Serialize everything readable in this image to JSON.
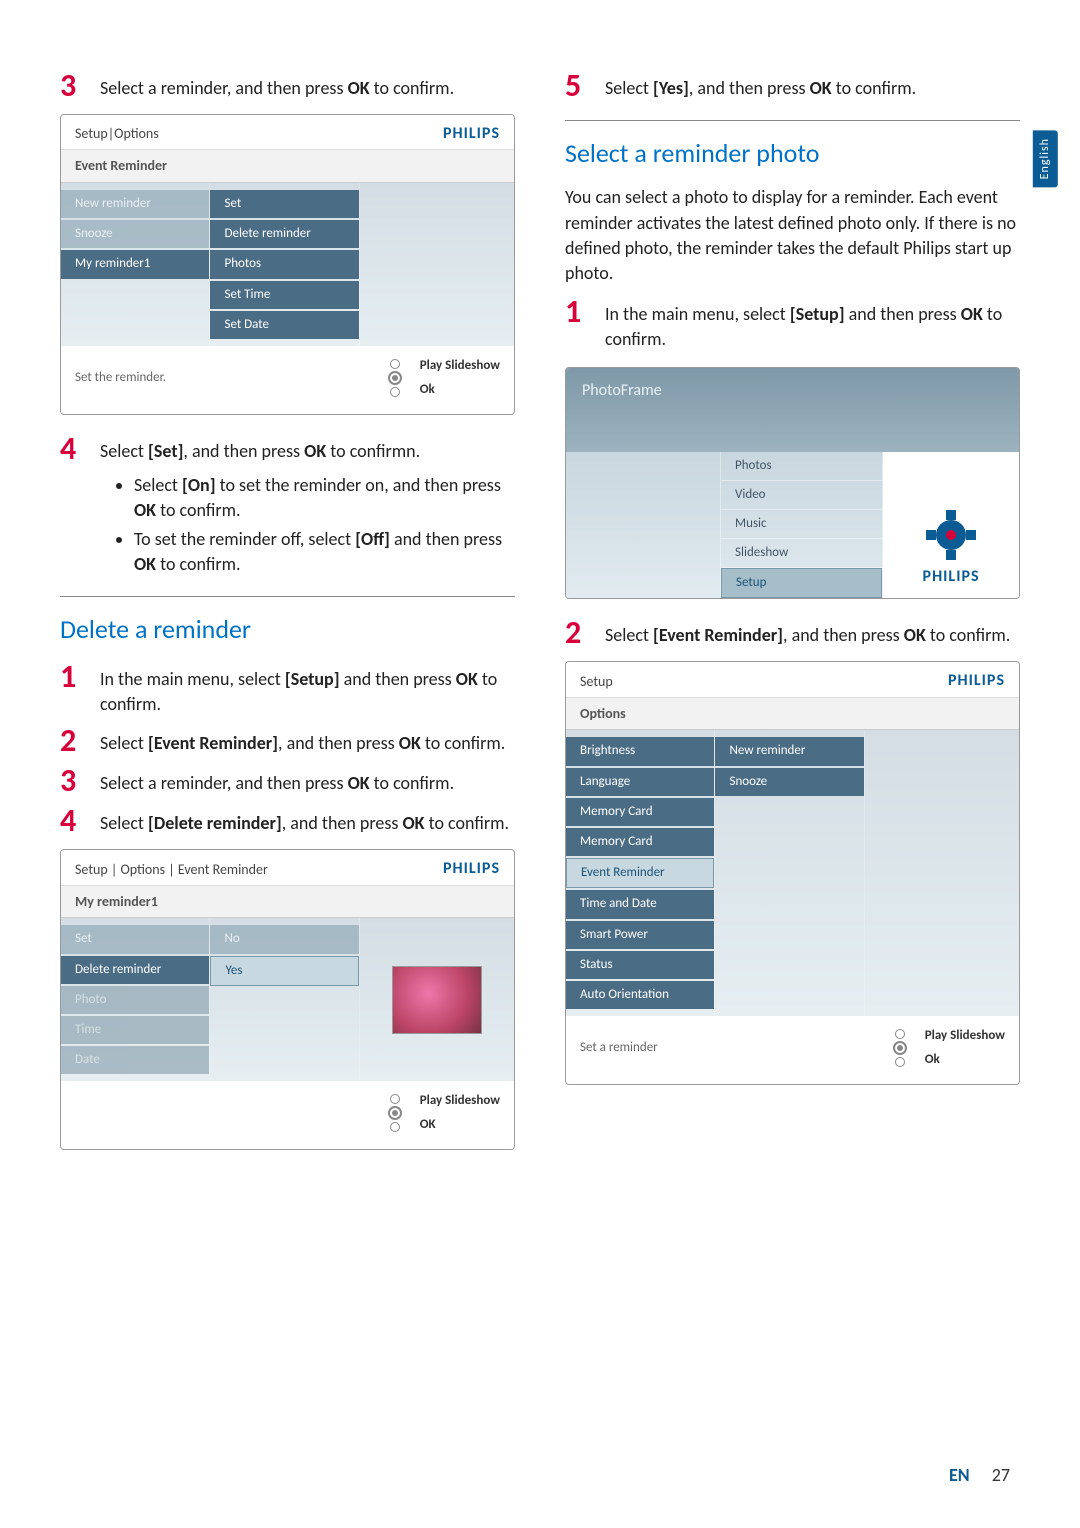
{
  "lang_tab": "English",
  "left": {
    "step3": {
      "num": "3",
      "text_a": "Select a reminder, and then press ",
      "ok": "OK",
      "text_b": " to confirm."
    },
    "device1": {
      "title": "Setup|Options",
      "brand": "PHILIPS",
      "subtitle": "Event Reminder",
      "col1": [
        "New reminder",
        "Snooze",
        "My reminder1"
      ],
      "col2": [
        "Set",
        "Delete reminder",
        "Photos",
        "Set Time",
        "Set Date"
      ],
      "footer_left": "Set the reminder.",
      "footer_labels": [
        "Play Slideshow",
        "Ok"
      ]
    },
    "step4": {
      "num": "4",
      "text_a": "Select ",
      "set": "[Set]",
      "text_b": ", and then press ",
      "ok": "OK",
      "text_c": " to confirmn.",
      "bullets": [
        {
          "a": "Select ",
          "b": "[On]",
          "c": " to set the reminder on, and then press ",
          "d": "OK",
          "e": " to confirm."
        },
        {
          "a": "To set the reminder off, select ",
          "b": "[Off]",
          "c": " and then press ",
          "d": "OK",
          "e": " to confirm."
        }
      ]
    },
    "delete_heading": "Delete a reminder",
    "del_steps": {
      "s1": {
        "num": "1",
        "a": "In the main menu, select ",
        "b": "[Setup]",
        "c": " and then press ",
        "d": "OK",
        "e": " to confirm."
      },
      "s2": {
        "num": "2",
        "a": "Select ",
        "b": "[Event Reminder]",
        "c": ", and then press ",
        "d": "OK",
        "e": " to confirm."
      },
      "s3": {
        "num": "3",
        "a": "Select a reminder, and then press ",
        "d": "OK",
        "e": " to confirm."
      },
      "s4": {
        "num": "4",
        "a": "Select ",
        "b": "[Delete reminder]",
        "c": ", and then press ",
        "d": "OK",
        "e": " to confirm."
      }
    },
    "device2": {
      "title": "Setup | Options | Event Reminder",
      "brand": "PHILIPS",
      "subtitle": "My reminder1",
      "col1": [
        "Set",
        "Delete reminder",
        "Photo",
        "Time",
        "Date"
      ],
      "col2": [
        "No",
        "Yes"
      ],
      "footer_left": "",
      "footer_labels": [
        "Play Slideshow",
        "OK"
      ]
    }
  },
  "right": {
    "step5": {
      "num": "5",
      "a": "Select ",
      "b": "[Yes]",
      "c": ", and then press ",
      "d": "OK",
      "e": " to confirm."
    },
    "select_heading": "Select a reminder photo",
    "intro": "You can select a photo to display for a reminder. Each event reminder activates the latest defined photo only. If there is no defined photo, the reminder takes the default Philips start up photo.",
    "step1": {
      "num": "1",
      "a": "In the main menu, select ",
      "b": "[Setup]",
      "c": " and then press ",
      "d": "OK",
      "e": " to confirm."
    },
    "pf": {
      "title": "PhotoFrame",
      "menu": [
        "Photos",
        "Video",
        "Music",
        "Slideshow",
        "Setup"
      ],
      "brand": "PHILIPS"
    },
    "step2": {
      "num": "2",
      "a": "Select ",
      "b": "[Event Reminder]",
      "c": ", and then press ",
      "d": "OK",
      "e": " to confirm."
    },
    "device3": {
      "title": "Setup",
      "brand": "PHILIPS",
      "subtitle": "Options",
      "col1": [
        "Brightness",
        "Language",
        "Memory Card",
        "Event Reminder",
        "Time and Date",
        "Smart Power",
        "Status",
        "Auto Orientation"
      ],
      "col2": [
        "New reminder",
        "Snooze"
      ],
      "footer_left": "Set a reminder",
      "footer_labels": [
        "Play Slideshow",
        "Ok"
      ]
    }
  },
  "footer": {
    "en": "EN",
    "page": "27"
  }
}
